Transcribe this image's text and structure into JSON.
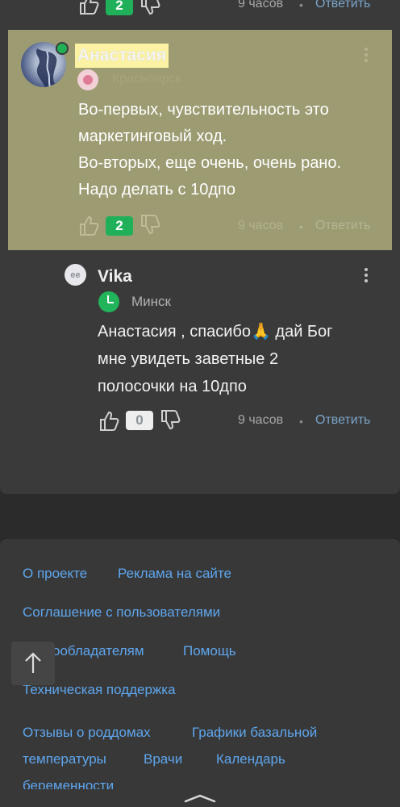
{
  "top_row": {
    "likes": "2",
    "time": "9 часов",
    "separator": "•",
    "reply": "Ответить"
  },
  "comment_highlighted": {
    "author": "Анастасия",
    "city": "Красноярск",
    "text_lines": [
      "Во-первых, чувствительность это",
      "маркетинговый ход.",
      "Во-вторых, еще очень, очень рано.",
      "Надо делать с 10дпо"
    ],
    "likes": "2",
    "time": "9 часов",
    "separator": "•",
    "reply": "Ответить"
  },
  "comment_reply": {
    "avatar_initials": "ee",
    "author": "Vika",
    "city": "Минск",
    "text_lines": [
      "Анастасия , спасибо🙏 дай Бог",
      "мне увидеть заветные 2",
      "полосочки на 10дпо"
    ],
    "likes": "0",
    "time": "9 часов",
    "separator": "•",
    "reply": "Ответить"
  },
  "footer": {
    "links": {
      "about": "О проекте",
      "ads": "Реклама на сайте",
      "agreement": "Соглашение с пользователями",
      "rights": "Правообладателям",
      "rights_visible": "ообладателям",
      "help": "Помощь",
      "support": "Техническая поддержка",
      "maternity": "Отзывы о роддомах",
      "charts": "Графики базальной",
      "charts2": "температуры",
      "doctors": "Врачи",
      "calendar": "Календарь",
      "calendar2": "беременности"
    }
  },
  "scroll_top_icon": "arrow-up-icon",
  "colors": {
    "highlight": "#9c9b72",
    "name_highlight": "#fbf2a4",
    "like_green": "#20b05a",
    "link_blue": "#5ea6ee",
    "reply_link": "#7aa4c8"
  }
}
